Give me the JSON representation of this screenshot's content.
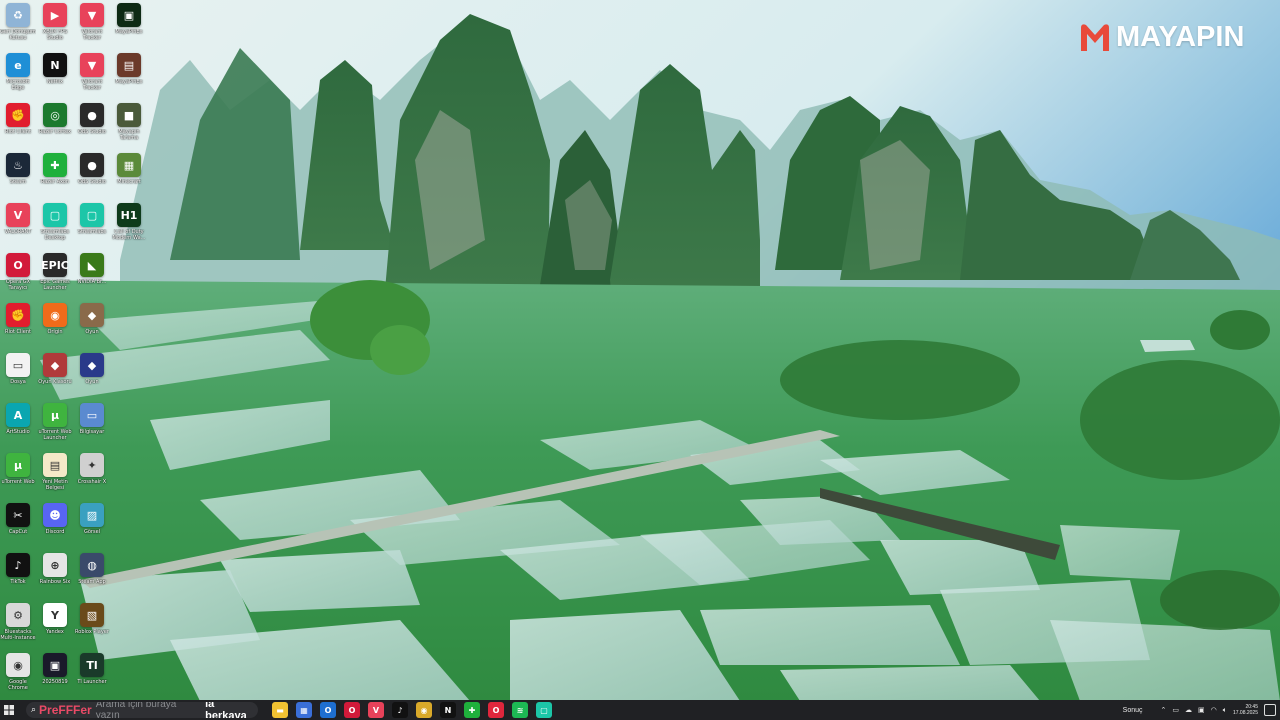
{
  "wallpaper": {
    "logo": {
      "prefix": "",
      "text": "MAYAPIN"
    }
  },
  "desktop": {
    "icons": [
      {
        "label": "Geri Dönüşüm Kutusu",
        "icon": "recycle-bin-icon",
        "color": "#8fb4d6",
        "glyph": "♻"
      },
      {
        "label": "XBOX FPS Studio",
        "icon": "fps-studio-icon",
        "color": "#e8425a",
        "glyph": "▶"
      },
      {
        "label": "Valorant Tracker",
        "icon": "valorant-tracker-icon",
        "color": "#e8425a",
        "glyph": "▼"
      },
      {
        "label": "MayaPinEx",
        "icon": "mayapin-app-icon",
        "color": "#0d2a14",
        "glyph": "▣"
      },
      {
        "label": "Microsoft Edge",
        "icon": "edge-icon",
        "color": "#1f8fd6",
        "glyph": "e"
      },
      {
        "label": "Netflix",
        "icon": "netflix-icon",
        "color": "#111111",
        "glyph": "N"
      },
      {
        "label": "Valorant Tracker",
        "icon": "valorant-tracker-icon",
        "color": "#e8425a",
        "glyph": "▼"
      },
      {
        "label": "MayaPinEx",
        "icon": "mayapin-app-icon",
        "color": "#6b3a2a",
        "glyph": "▤"
      },
      {
        "label": "Riot Client",
        "icon": "riot-client-icon",
        "color": "#e11d2e",
        "glyph": "✊"
      },
      {
        "label": "Razer Cortex",
        "icon": "razer-cortex-icon",
        "color": "#1c7a2e",
        "glyph": "◎"
      },
      {
        "label": "OBS Studio",
        "icon": "obs-studio-icon",
        "color": "#2a2a2a",
        "glyph": "●"
      },
      {
        "label": "Mayapin Tarama",
        "icon": "mayapin-tool-icon",
        "color": "#4a5a3a",
        "glyph": "■"
      },
      {
        "label": "Steam",
        "icon": "steam-icon",
        "color": "#1b2838",
        "glyph": "♨"
      },
      {
        "label": "Razer Axon",
        "icon": "razer-axon-icon",
        "color": "#1fb03c",
        "glyph": "✚"
      },
      {
        "label": "OBS Studio",
        "icon": "obs-studio-icon",
        "color": "#2a2a2a",
        "glyph": "●"
      },
      {
        "label": "Minecraft",
        "icon": "minecraft-icon",
        "color": "#5b8a3a",
        "glyph": "▦"
      },
      {
        "label": "VALORANT",
        "icon": "valorant-icon",
        "color": "#e8425a",
        "glyph": "V"
      },
      {
        "label": "Streamlabs Desktop",
        "icon": "streamlabs-icon",
        "color": "#1cc6a8",
        "glyph": "▢"
      },
      {
        "label": "Streamlabs",
        "icon": "streamlabs-icon",
        "color": "#1cc6a8",
        "glyph": "▢"
      },
      {
        "label": "Call of Duty Modern Wa...",
        "icon": "call-of-duty-icon",
        "color": "#0e3b1b",
        "glyph": "H1"
      },
      {
        "label": "Opera GX Tarayıcı",
        "icon": "opera-gx-icon",
        "color": "#d21a3a",
        "glyph": "O"
      },
      {
        "label": "Epic Games Launcher",
        "icon": "epic-games-icon",
        "color": "#2a2a2a",
        "glyph": "EPIC"
      },
      {
        "label": "NVIDIA Br...",
        "icon": "nvidia-icon",
        "color": "#3a7a1a",
        "glyph": "◣"
      },
      {
        "label": "",
        "icon": "blank-icon",
        "color": "transparent",
        "glyph": ""
      },
      {
        "label": "Riot Client",
        "icon": "riot-client-icon",
        "color": "#e11d2e",
        "glyph": "✊"
      },
      {
        "label": "Origin",
        "icon": "origin-icon",
        "color": "#f06b1a",
        "glyph": "◉"
      },
      {
        "label": "Oyun",
        "icon": "game-shortcut-icon",
        "color": "#8a6a4a",
        "glyph": "◆"
      },
      {
        "label": "",
        "icon": "blank-icon",
        "color": "transparent",
        "glyph": ""
      },
      {
        "label": "Dosya",
        "icon": "file-icon",
        "color": "#f2f2f2",
        "glyph": "▭"
      },
      {
        "label": "Oyun Klasörü",
        "icon": "game-folder-icon",
        "color": "#b03a3a",
        "glyph": "◆"
      },
      {
        "label": "Oyun",
        "icon": "game-shortcut-icon",
        "color": "#2a3a8a",
        "glyph": "◆"
      },
      {
        "label": "",
        "icon": "blank-icon",
        "color": "transparent",
        "glyph": ""
      },
      {
        "label": "ArtStudio",
        "icon": "artstudio-icon",
        "color": "#0aa6b0",
        "glyph": "A"
      },
      {
        "label": "uTorrent Web Launcher",
        "icon": "utorrent-icon",
        "color": "#3fb43f",
        "glyph": "μ"
      },
      {
        "label": "Bilgisayar",
        "icon": "computer-icon",
        "color": "#5a8ad0",
        "glyph": "▭"
      },
      {
        "label": "",
        "icon": "blank-icon",
        "color": "transparent",
        "glyph": ""
      },
      {
        "label": "uTorrent Web",
        "icon": "utorrent-icon",
        "color": "#3fb43f",
        "glyph": "μ"
      },
      {
        "label": "Yeni Metin Belgesi",
        "icon": "text-document-icon",
        "color": "#f4e9c8",
        "glyph": "▤"
      },
      {
        "label": "Crosshair X",
        "icon": "crosshair-icon",
        "color": "#d0d0d0",
        "glyph": "✦"
      },
      {
        "label": "",
        "icon": "blank-icon",
        "color": "transparent",
        "glyph": ""
      },
      {
        "label": "CapCut",
        "icon": "capcut-icon",
        "color": "#111111",
        "glyph": "✂"
      },
      {
        "label": "Discord",
        "icon": "discord-icon",
        "color": "#5865f2",
        "glyph": "☻"
      },
      {
        "label": "Görsel",
        "icon": "image-icon",
        "color": "#3aa0c0",
        "glyph": "▨"
      },
      {
        "label": "",
        "icon": "blank-icon",
        "color": "transparent",
        "glyph": ""
      },
      {
        "label": "TikTok",
        "icon": "tiktok-icon",
        "color": "#111111",
        "glyph": "♪"
      },
      {
        "label": "Rainbow Six",
        "icon": "rainbow-six-icon",
        "color": "#e5e5e5",
        "glyph": "⊕"
      },
      {
        "label": "Steam App",
        "icon": "steam-app-icon",
        "color": "#3a4a6a",
        "glyph": "◍"
      },
      {
        "label": "",
        "icon": "blank-icon",
        "color": "transparent",
        "glyph": ""
      },
      {
        "label": "Bluestacks Multi-Instance",
        "icon": "bluestacks-icon",
        "color": "#d8d8d8",
        "glyph": "⚙"
      },
      {
        "label": "Yandex",
        "icon": "yandex-icon",
        "color": "#ffffff",
        "glyph": "Y"
      },
      {
        "label": "Roblox Player",
        "icon": "roblox-icon",
        "color": "#6a4a1a",
        "glyph": "▧"
      },
      {
        "label": "",
        "icon": "blank-icon",
        "color": "transparent",
        "glyph": ""
      },
      {
        "label": "Google Chrome",
        "icon": "chrome-icon",
        "color": "#e5e5e5",
        "glyph": "◉"
      },
      {
        "label": "20250819",
        "icon": "video-file-icon",
        "color": "#1a1a2a",
        "glyph": "▣"
      },
      {
        "label": "Tl Launcher",
        "icon": "tlauncher-icon",
        "color": "#1a3a2a",
        "glyph": "Tl"
      }
    ]
  },
  "taskbar": {
    "search": {
      "brand": "PreFFFer",
      "placeholder": "Arama için buraya yazın",
      "trail": "la berkaya"
    },
    "apps": [
      {
        "icon": "file-explorer-icon",
        "color": "#f1c232",
        "glyph": "▬"
      },
      {
        "icon": "calendar-app-icon",
        "color": "#3a6fd8",
        "glyph": "▦"
      },
      {
        "icon": "outlook-icon",
        "color": "#1e6fd0",
        "glyph": "O"
      },
      {
        "icon": "opera-gx-icon",
        "color": "#d21a3a",
        "glyph": "O"
      },
      {
        "icon": "valorant-icon",
        "color": "#e8425a",
        "glyph": "V"
      },
      {
        "icon": "tiktok-icon",
        "color": "#111111",
        "glyph": "♪"
      },
      {
        "icon": "chrome-icon",
        "color": "#d9a92a",
        "glyph": "◉"
      },
      {
        "icon": "netflix-icon",
        "color": "#111111",
        "glyph": "N"
      },
      {
        "icon": "razer-icon",
        "color": "#1fb03c",
        "glyph": "✚"
      },
      {
        "icon": "opera-icon",
        "color": "#e0263c",
        "glyph": "O"
      },
      {
        "icon": "spotify-icon",
        "color": "#1db954",
        "glyph": "≋"
      },
      {
        "icon": "streamlabs-icon",
        "color": "#1cc6a8",
        "glyph": "▢"
      }
    ],
    "tray": {
      "weather": "Sonuç",
      "time": "20:45",
      "date": "17.08.2025"
    }
  }
}
